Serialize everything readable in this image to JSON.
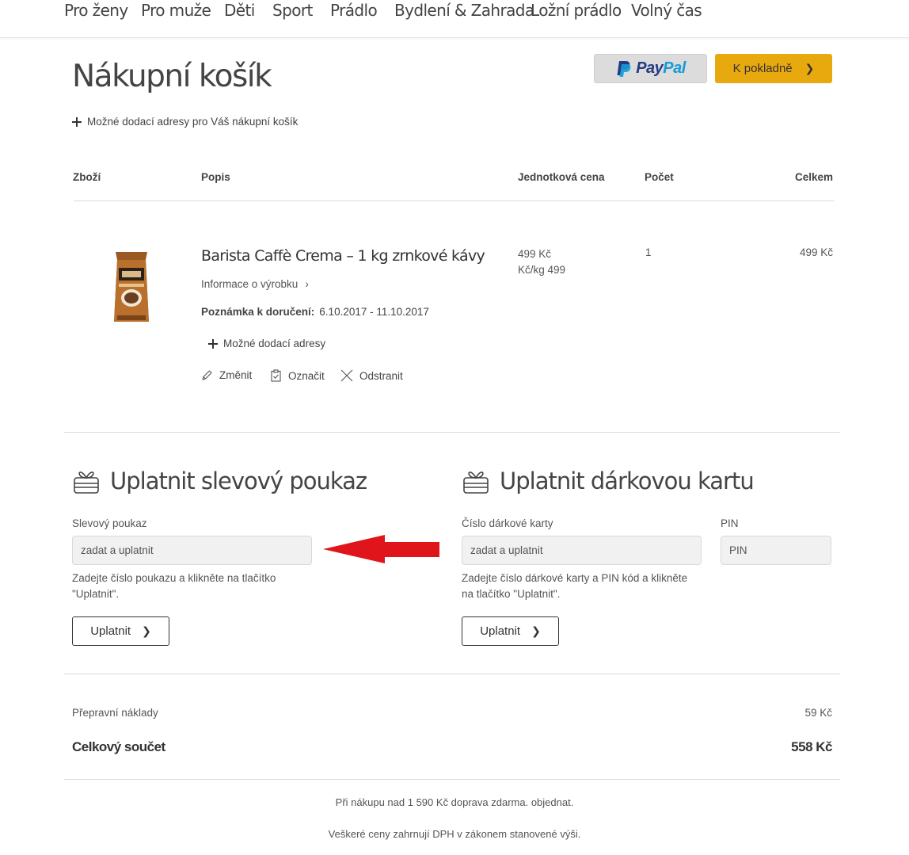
{
  "nav": {
    "items": [
      "Pro ženy",
      "Pro muže",
      "Děti",
      "Sport",
      "Prádlo",
      "Bydlení & Zahrada",
      "Ložní prádlo",
      "Volný čas"
    ]
  },
  "header": {
    "title": "Nákupní košík",
    "paypal_pay": "Pay",
    "paypal_pal": "Pal",
    "checkout_label": "K pokladně"
  },
  "cart": {
    "delivery_addresses_link": "Možné dodací adresy pro Váš nákupní košík",
    "columns": {
      "item": "Zboží",
      "description": "Popis",
      "unit_price": "Jednotková cena",
      "quantity": "Počet",
      "total": "Celkem"
    },
    "items": [
      {
        "name": "Barista Caffè Crema – 1 kg zrnkové kávy",
        "info_link": "Informace o výrobku",
        "delivery_note_label": "Poznámka k doručení:",
        "delivery_note_value": "6.10.2017 - 11.10.2017",
        "delivery_addresses_link": "Možné dodací adresy",
        "actions": {
          "edit": "Změnit",
          "mark": "Označit",
          "remove": "Odstranit"
        },
        "unit_price": "499 Kč",
        "price_per_kg": "Kč/kg 499",
        "quantity": "1",
        "total": "499 Kč"
      }
    ]
  },
  "voucher": {
    "title": "Uplatnit slevový poukaz",
    "field_label": "Slevový poukaz",
    "placeholder": "zadat a uplatnit",
    "hint": "Zadejte číslo poukazu a klikněte na tlačítko \"Uplatnit\".",
    "button": "Uplatnit"
  },
  "gift_card": {
    "title": "Uplatnit dárkovou kartu",
    "card_label": "Číslo dárkové karty",
    "card_placeholder": "zadat a uplatnit",
    "pin_label": "PIN",
    "pin_placeholder": "PIN",
    "hint": "Zadejte číslo dárkové karty a PIN kód a klikněte na tlačítko \"Uplatnit\".",
    "button": "Uplatnit"
  },
  "summary": {
    "shipping_label": "Přepravní náklady",
    "shipping_value": "59 Kč",
    "total_label": "Celkový součet",
    "total_value": "558 Kč"
  },
  "footer": {
    "free_shipping": "Při nákupu nad 1 590 Kč doprava zdarma. objednat.",
    "vat_note": "Veškeré ceny zahrnují DPH v zákonem stanovené výši."
  },
  "colors": {
    "checkout": "#e8a90e",
    "paypal_button": "#dcdcdc",
    "arrow": "#e0141b"
  },
  "icons": [
    "plus-icon",
    "chevron-right-icon",
    "pencil-icon",
    "clipboard-check-icon",
    "close-icon",
    "gift-icon",
    "paypal-logo-icon"
  ]
}
